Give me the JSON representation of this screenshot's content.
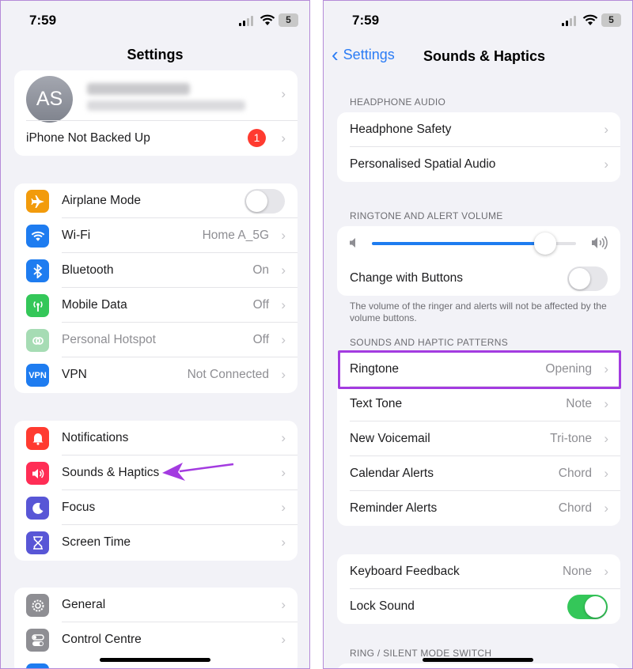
{
  "status": {
    "time": "7:59",
    "battery": "5"
  },
  "left": {
    "title": "Settings",
    "profile": {
      "initials": "AS"
    },
    "backup": {
      "label": "iPhone Not Backed Up",
      "badge": "1"
    },
    "connectivity": [
      {
        "label": "Airplane Mode",
        "icon": "airplane-icon",
        "color": "#f29b0c",
        "toggle": false
      },
      {
        "label": "Wi-Fi",
        "value": "Home A_5G",
        "icon": "wifi-icon",
        "color": "#1e7cf0"
      },
      {
        "label": "Bluetooth",
        "value": "On",
        "icon": "bluetooth-icon",
        "color": "#1e7cf0"
      },
      {
        "label": "Mobile Data",
        "value": "Off",
        "icon": "antenna-icon",
        "color": "#34c759"
      },
      {
        "label": "Personal Hotspot",
        "value": "Off",
        "icon": "hotspot-icon",
        "color": "#a6dcb4",
        "dimmed": true
      },
      {
        "label": "VPN",
        "value": "Not Connected",
        "icon": "vpn-icon",
        "color": "#1e7cf0",
        "icon_text": "VPN"
      }
    ],
    "notifications_group": [
      {
        "label": "Notifications",
        "icon": "bell-icon",
        "color": "#ff3b30"
      },
      {
        "label": "Sounds & Haptics",
        "icon": "speaker-icon",
        "color": "#ff2d55"
      },
      {
        "label": "Focus",
        "icon": "moon-icon",
        "color": "#5856d6"
      },
      {
        "label": "Screen Time",
        "icon": "hourglass-icon",
        "color": "#5856d6"
      }
    ],
    "general_group": [
      {
        "label": "General",
        "icon": "gear-icon",
        "color": "#8e8e93"
      },
      {
        "label": "Control Centre",
        "icon": "switches-icon",
        "color": "#8e8e93"
      }
    ]
  },
  "right": {
    "back_label": "Settings",
    "title": "Sounds & Haptics",
    "headphone_header": "HEADPHONE AUDIO",
    "headphone_rows": [
      {
        "label": "Headphone Safety"
      },
      {
        "label": "Personalised Spatial Audio"
      }
    ],
    "volume_header": "RINGTONE AND ALERT VOLUME",
    "volume_level": 0.85,
    "change_with_buttons": {
      "label": "Change with Buttons",
      "toggle": false
    },
    "volume_footnote": "The volume of the ringer and alerts will not be affected by the volume buttons.",
    "patterns_header": "SOUNDS AND HAPTIC PATTERNS",
    "patterns": [
      {
        "label": "Ringtone",
        "value": "Opening"
      },
      {
        "label": "Text Tone",
        "value": "Note"
      },
      {
        "label": "New Voicemail",
        "value": "Tri-tone"
      },
      {
        "label": "Calendar Alerts",
        "value": "Chord"
      },
      {
        "label": "Reminder Alerts",
        "value": "Chord"
      }
    ],
    "feedback_rows": [
      {
        "label": "Keyboard Feedback",
        "value": "None"
      },
      {
        "label": "Lock Sound",
        "toggle": true
      }
    ],
    "silent_header": "RING / SILENT MODE SWITCH"
  },
  "colors": {
    "accent": "#2b7cf5",
    "highlight": "#a33be0",
    "toggle_on": "#34c759"
  }
}
